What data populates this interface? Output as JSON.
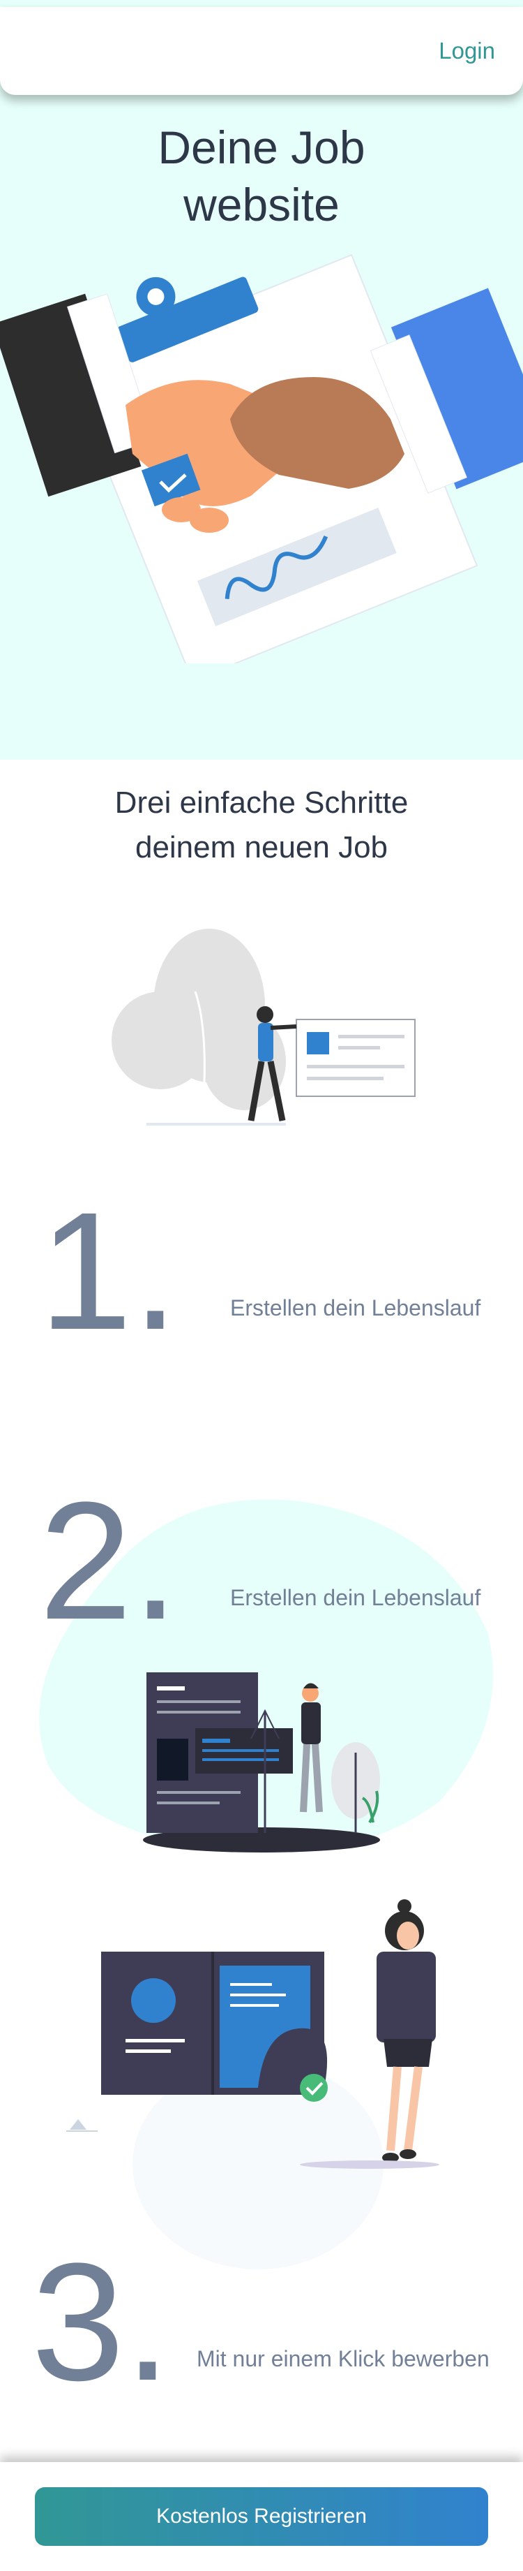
{
  "header": {
    "login_label": "Login"
  },
  "hero": {
    "title_line1": "Deine Job",
    "title_line2": "website"
  },
  "steps": {
    "title_line1": "Drei einfache Schritte",
    "title_line2": "deinem neuen Job",
    "items": [
      {
        "number": "1.",
        "label": "Erstellen dein Lebenslauf"
      },
      {
        "number": "2.",
        "label": "Erstellen dein Lebenslauf"
      },
      {
        "number": "3.",
        "label": "Mit nur einem Klick bewerben"
      }
    ]
  },
  "cta": {
    "label": "Kostenlos Registrieren"
  },
  "colors": {
    "accent": "#319795",
    "accent2": "#3182ce",
    "hero_bg": "#e6fffa",
    "text_muted": "#718096"
  }
}
